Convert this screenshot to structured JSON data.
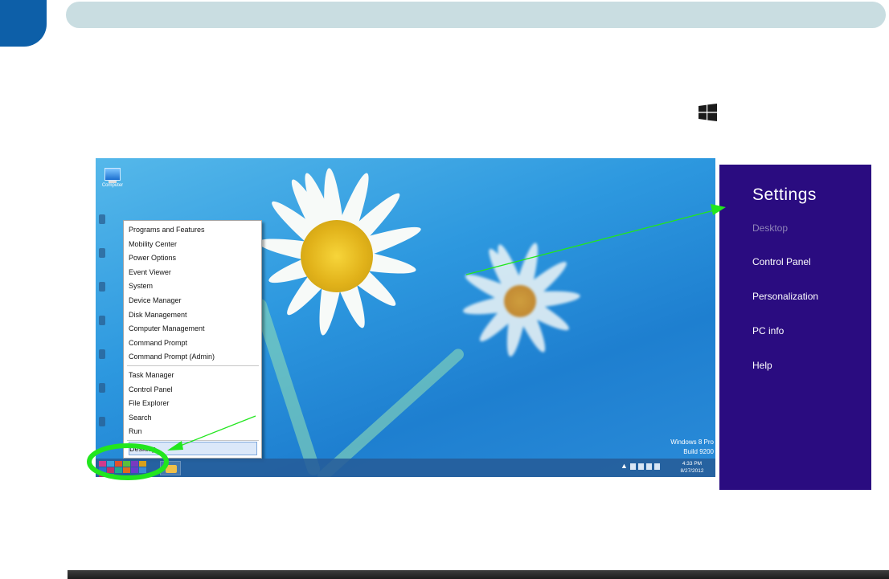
{
  "context_menu": {
    "group1": [
      "Programs and Features",
      "Mobility Center",
      "Power Options",
      "Event Viewer",
      "System",
      "Device Manager",
      "Disk Management",
      "Computer Management",
      "Command Prompt",
      "Command Prompt (Admin)"
    ],
    "group2": [
      "Task Manager",
      "Control Panel",
      "File Explorer",
      "Search",
      "Run"
    ],
    "desktop_item": "Desktop"
  },
  "desktop": {
    "computer_icon_label": "Computer"
  },
  "watermark": {
    "line1": "Windows 8 Pro",
    "line2": "Build 9200"
  },
  "clock": {
    "time": "4:33 PM",
    "date": "8/27/2012"
  },
  "settings": {
    "title": "Settings",
    "items": [
      "Desktop",
      "Control Panel",
      "Personalization",
      "PC info",
      "Help"
    ]
  },
  "colors": {
    "header_tab": "#0d5fa8",
    "header_bar": "#c9dde1",
    "settings_bg": "#2a0c80",
    "annotation_green": "#22e61e"
  }
}
